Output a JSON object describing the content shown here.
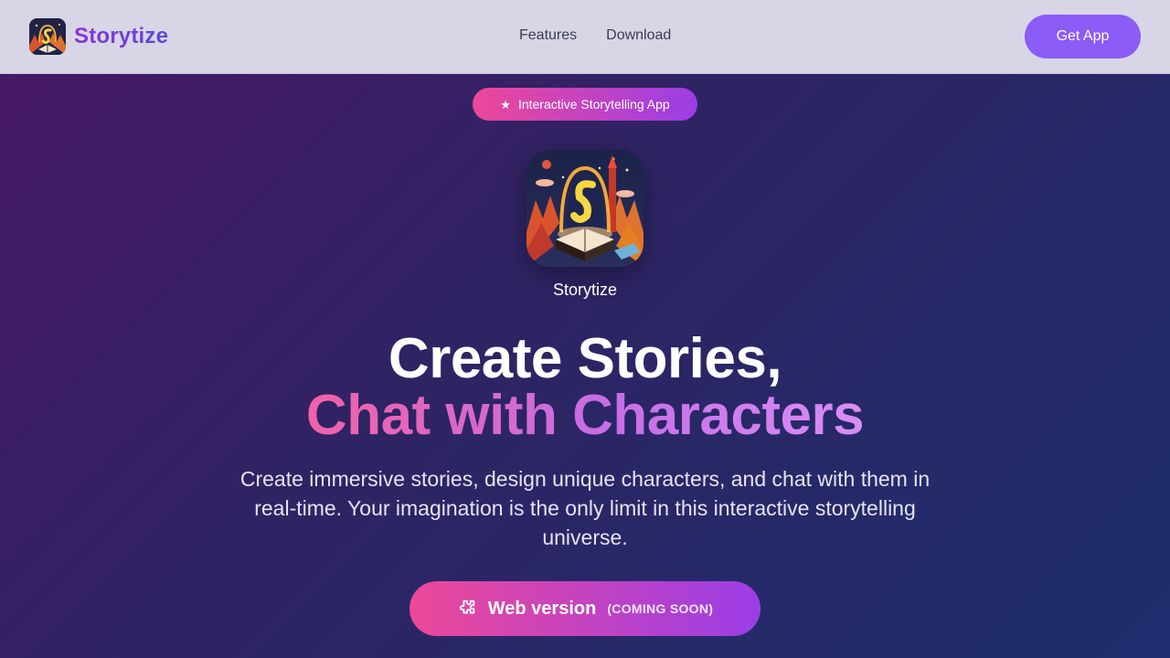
{
  "header": {
    "brand_name": "Storytize",
    "nav": [
      {
        "label": "Features"
      },
      {
        "label": "Download"
      }
    ],
    "cta_label": "Get App"
  },
  "badge": {
    "icon": "star-icon",
    "label": "Interactive Storytelling App"
  },
  "app": {
    "icon": "storytize-app-icon",
    "name": "Storytize"
  },
  "hero": {
    "title_line1": "Create Stories,",
    "title_line2": "Chat with Characters",
    "description": "Create immersive stories, design unique characters, and chat with them in real-time. Your imagination is the only limit in this interactive storytelling universe."
  },
  "cta": {
    "icon": "puzzle-icon",
    "label": "Web version",
    "sublabel": "(COMING SOON)"
  },
  "colors": {
    "brand": "#7c3aed",
    "button": "#8b5cf6",
    "pink": "#ec4899",
    "purple": "#9b3ee6",
    "header_bg": "#d8d6e6"
  }
}
